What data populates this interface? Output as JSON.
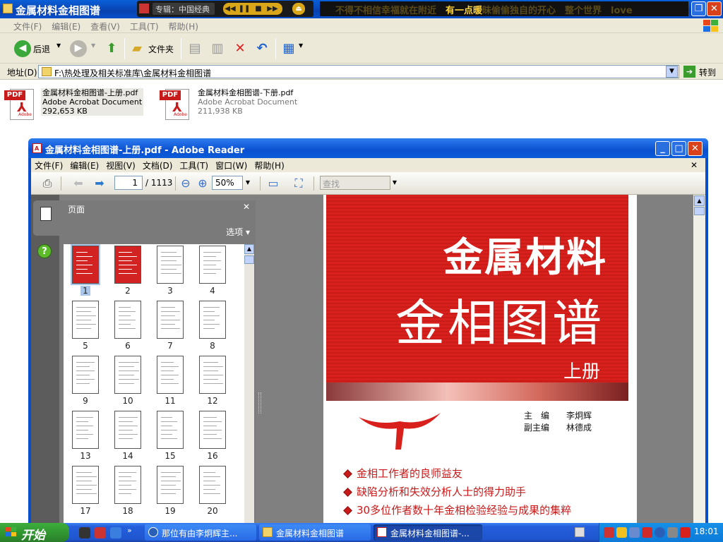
{
  "explorer": {
    "title": "金属材料金相图谱",
    "menu": [
      "文件(F)",
      "编辑(E)",
      "查看(V)",
      "工具(T)",
      "帮助(H)"
    ],
    "toolbar": {
      "back_label": "后退",
      "folders_label": "文件夹"
    },
    "address": {
      "label": "地址(D)",
      "path": "F:\\热处理及相关标准库\\金属材料金相图谱",
      "go_label": "转到"
    },
    "files": [
      {
        "name": "金属材料金相图谱-上册.pdf",
        "type": "Adobe Acrobat Document",
        "size": "292,653 KB",
        "icon": "pdf-file-icon"
      },
      {
        "name": "金属材料金相图谱-下册.pdf",
        "type": "Adobe Acrobat Document",
        "size": "211,938 KB",
        "icon": "pdf-file-icon"
      }
    ]
  },
  "media_player": {
    "album": "专辑：中国经典",
    "lyrics_dim1": "不得不相信幸福就在附近",
    "lyrics_highlight": "有一点暖",
    "lyrics_dim2": "昧偷偷独自的开心　整个世界　love"
  },
  "reader": {
    "title": "金属材料金相图谱-上册.pdf - Adobe Reader",
    "menu": [
      "文件(F)",
      "编辑(E)",
      "视图(V)",
      "文档(D)",
      "工具(T)",
      "窗口(W)",
      "帮助(H)"
    ],
    "current_page": "1",
    "total_pages": "/ 1113",
    "zoom": "50%",
    "find_placeholder": "查找",
    "panel_title": "页面",
    "panel_options": "选项",
    "thumbnails": [
      "1",
      "2",
      "3",
      "4",
      "5",
      "6",
      "7",
      "8",
      "9",
      "10",
      "11",
      "12",
      "13",
      "14",
      "15",
      "16",
      "17",
      "18",
      "19",
      "20"
    ],
    "selected_thumbnail": "1",
    "cover": {
      "title_line1": "金属材料",
      "title_line2": "金相图谱",
      "volume": "上册",
      "editor_line1": "主　编　　李炯辉",
      "editor_line2": "副主编　　林德成",
      "bullets": [
        "金相工作者的良师益友",
        "缺陷分析和失效分析人士的得力助手",
        "30多位作者数十年金相检验经验与成果的集粹"
      ]
    }
  },
  "taskbar": {
    "start_label": "开始",
    "tasks": [
      {
        "label": "那位有由李炯辉主...",
        "icon": "maxthon-icon",
        "active": false
      },
      {
        "label": "金属材料金相图谱",
        "icon": "folder-icon",
        "active": false
      },
      {
        "label": "金属材料金相图谱-...",
        "icon": "adobe-reader-icon",
        "active": true
      }
    ],
    "clock": "18:01"
  },
  "colors": {
    "xp_blue": "#0a50d0",
    "cover_red": "#d8201d",
    "start_green": "#2f932f"
  }
}
